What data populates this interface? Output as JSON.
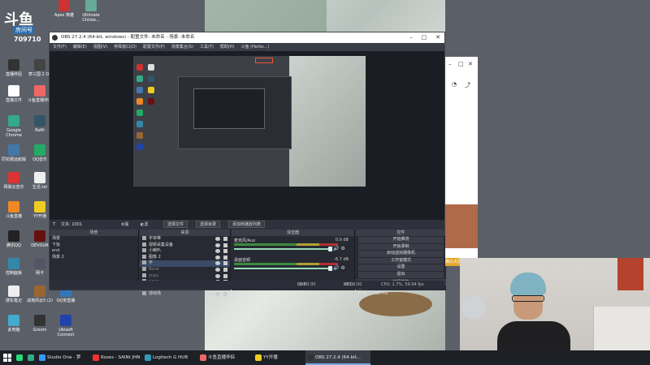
{
  "stream_logo": {
    "line1": "斗鱼",
    "line2": "房间号",
    "room_number": "709710"
  },
  "desktop_icons": [
    {
      "label": "",
      "color": "#ddd"
    },
    {
      "label": "Apex 英雄",
      "color": "#c33"
    },
    {
      "label": "Ultimate Chicke...",
      "color": "#6a9"
    },
    {
      "label": "直播伴侣",
      "color": "#333"
    },
    {
      "label": "梦三国 2 OL",
      "color": "#444"
    },
    {
      "label": "直播文件",
      "color": "#fff"
    },
    {
      "label": "斗鱼直播伴侣",
      "color": "#e66"
    },
    {
      "label": "Google Chrome",
      "color": "#3a8"
    },
    {
      "label": "Rafti",
      "color": "#356"
    },
    {
      "label": "同花顺远航版",
      "color": "#47a"
    },
    {
      "label": "QQ音乐",
      "color": "#2a6"
    },
    {
      "label": "网易云音乐",
      "color": "#d33"
    },
    {
      "label": "生活.txt",
      "color": "#eee"
    },
    {
      "label": "斗鱼直播",
      "color": "#e82"
    },
    {
      "label": "YY开播",
      "color": "#ec2"
    },
    {
      "label": "腾讯QQ",
      "color": "#222"
    },
    {
      "label": "DEVOUR",
      "color": "#611"
    },
    {
      "label": "控制面板",
      "color": "#38a"
    },
    {
      "label": "网卡",
      "color": "#556"
    },
    {
      "label": "搜车笔记",
      "color": "#eee"
    },
    {
      "label": "战地风云5 (2)",
      "color": "#963"
    },
    {
      "label": "QQ安直播",
      "color": "#37b"
    },
    {
      "label": "此电脑",
      "color": "#4ac"
    },
    {
      "label": "Groom",
      "color": "#333"
    },
    {
      "label": "Ubisoft Connect",
      "color": "#24a"
    }
  ],
  "obs": {
    "title": "OBS 27.2.4 (64-bit, windows) - 配置文件: 未命名 - 场景: 未命名",
    "menu": [
      "文件(F)",
      "编辑(E)",
      "视图(V)",
      "停靠窗口(D)",
      "配置文件(P)",
      "场景集合(S)",
      "工具(T)",
      "帮助(H)",
      "斗鱼 (Herbs...)"
    ],
    "source_toolbar": {
      "source_name": "文本: 1001",
      "properties": "属性",
      "filters": "滤镜",
      "select_file": "选择文件",
      "select_folder": "选择目录",
      "add_playlist": "添加到播放列表"
    },
    "scenes": {
      "title": "场景",
      "items": [
        "场景",
        "下饭",
        "end",
        "场景 2"
      ]
    },
    "sources": {
      "title": "来源",
      "items": [
        "字目等",
        "视频采集设备",
        "小喇叭",
        "图像 2",
        "字",
        "Bone",
        "yuyu",
        "ringo",
        "nex",
        "游戏场"
      ]
    },
    "mixer": {
      "title": "混音器",
      "channels": [
        {
          "name": "麦克风/Aux",
          "db": "0.0 dB"
        },
        {
          "name": "桌面音频",
          "db": "-6.7 dB"
        }
      ]
    },
    "controls": {
      "title": "控件",
      "buttons": [
        "开始推流",
        "开始录制",
        "启动虚拟摄像机",
        "工作室模式",
        "设置",
        "退出"
      ]
    },
    "transitions": {
      "title": "转场特效",
      "selected": "淡出",
      "duration_label": "时长",
      "duration": "50 ms"
    },
    "status": {
      "live_label": "LIVE:",
      "live_time": "00:00:00",
      "rec_label": "REC:",
      "rec_time": "00:00:00",
      "cpu": "CPU: 1.7%, 59.94 fps"
    }
  },
  "side_window": {
    "badge": "确认大屏"
  },
  "taskbar": {
    "items": [
      {
        "label": "",
        "color": "#2d7"
      },
      {
        "label": "",
        "color": "#3a8"
      },
      {
        "label": "Studio One - 梦三...",
        "color": "#39f"
      },
      {
        "label": "Roses - SAINt JHN",
        "color": "#e33"
      },
      {
        "label": "Logitech G HUB",
        "color": "#39b"
      },
      {
        "label": "斗鱼直播伴侣",
        "color": "#e66"
      },
      {
        "label": "YY开播",
        "color": "#ec2"
      },
      {
        "label": "OBS 27.2.4 (64-bit...",
        "color": "#333"
      }
    ]
  }
}
